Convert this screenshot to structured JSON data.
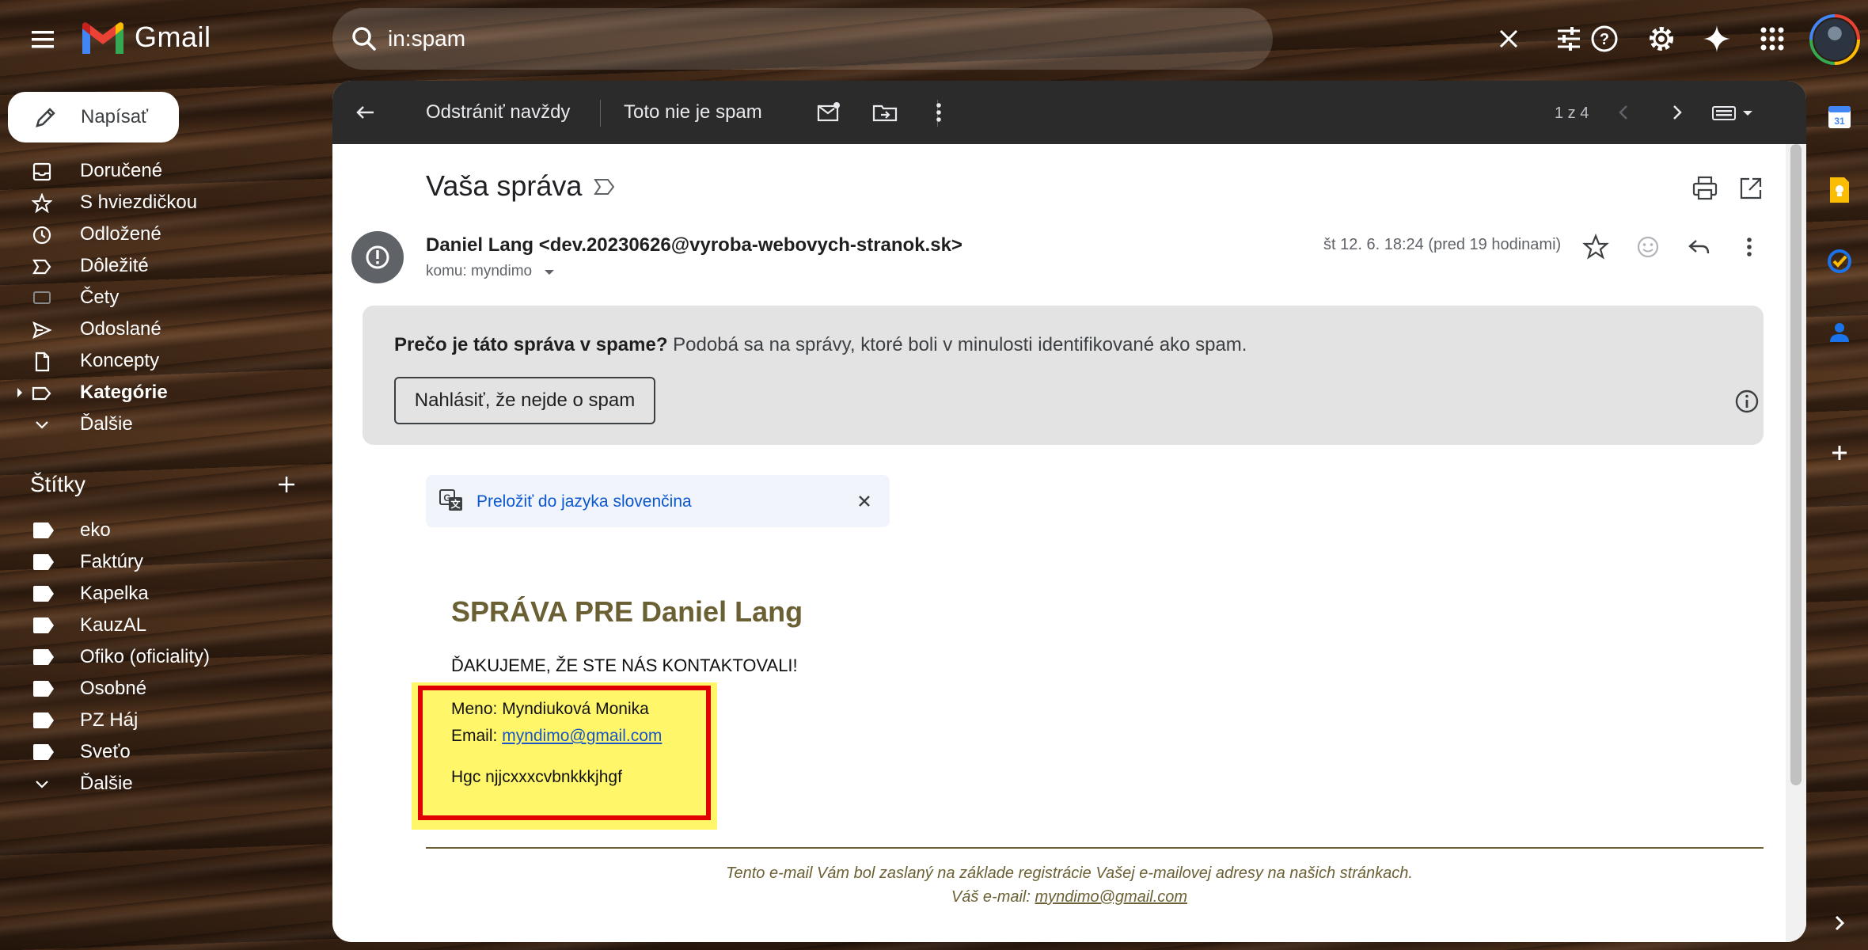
{
  "app": {
    "name": "Gmail"
  },
  "search": {
    "value": "in:spam"
  },
  "compose": {
    "label": "Napísať"
  },
  "nav": {
    "items": [
      {
        "label": "Doručené"
      },
      {
        "label": "S hviezdičkou"
      },
      {
        "label": "Odložené"
      },
      {
        "label": "Dôležité"
      },
      {
        "label": "Čety"
      },
      {
        "label": "Odoslané"
      },
      {
        "label": "Koncepty"
      },
      {
        "label": "Kategórie"
      },
      {
        "label": "Ďalšie"
      }
    ]
  },
  "labels": {
    "header": "Štítky",
    "items": [
      {
        "label": "eko"
      },
      {
        "label": "Faktúry"
      },
      {
        "label": "Kapelka"
      },
      {
        "label": "KauzAL"
      },
      {
        "label": "Ofiko (oficiality)"
      },
      {
        "label": "Osobné"
      },
      {
        "label": "PZ Háj"
      },
      {
        "label": "Sveťo"
      },
      {
        "label": "Ďalšie"
      }
    ]
  },
  "toolbar": {
    "delete_forever": "Odstrániť navždy",
    "not_spam": "Toto nie je spam",
    "pager": "1 z 4"
  },
  "message": {
    "subject": "Vaša správa",
    "sender": "Daniel Lang <dev.20230626@vyroba-webovych-stranok.sk>",
    "recipient": "komu: myndimo",
    "date": "št 12. 6. 18:24 (pred 19 hodinami)"
  },
  "spam_notice": {
    "question": "Prečo je táto správa v spame?",
    "explanation": "Podobá sa na správy, ktoré boli v minulosti identifikované ako spam.",
    "button": "Nahlásiť, že nejde o spam"
  },
  "translate": {
    "link": "Preložiť do jazyka slovenčina"
  },
  "body": {
    "heading": "SPRÁVA PRE Daniel Lang",
    "thanks": "ĎAKUJEME, ŽE STE NÁS KONTAKTOVALI!",
    "name_line": "Meno: Myndiuková Monika",
    "email_label": "Email:",
    "email_value": "myndimo@gmail.com",
    "message_line": "Hgc njjcxxxcvbnkkkjhgf",
    "footer_line1": "Tento e-mail Vám bol zaslaný na základe registrácie Vašej e-mailovej adresy na našich stránkach.",
    "footer_label": "Váš e-mail:",
    "footer_email": "myndimo@gmail.com"
  },
  "colors": {
    "annotation_box": "#e00000",
    "annotation_highlight": "#fff66a",
    "heading": "#6b6033",
    "link": "#0b57d0"
  }
}
